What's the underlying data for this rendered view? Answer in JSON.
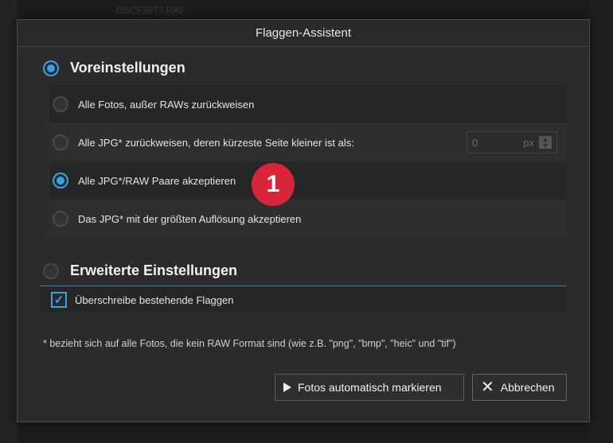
{
  "background": {
    "filename": "DSCF3977.RAF"
  },
  "dialog": {
    "title": "Flaggen-Assistent",
    "presets": {
      "label": "Voreinstellungen",
      "selected": true,
      "options": [
        {
          "label": "Alle Fotos, außer RAWs zurückweisen",
          "selected": false
        },
        {
          "label": "Alle JPG* zurückweisen, deren kürzeste Seite kleiner ist als:",
          "selected": false,
          "field_value": "0",
          "field_unit": "px"
        },
        {
          "label": "Alle JPG*/RAW Paare akzeptieren",
          "selected": true
        },
        {
          "label": "Das JPG* mit der größten Auflösung akzeptieren",
          "selected": false
        }
      ]
    },
    "badge": "1",
    "advanced": {
      "label": "Erweiterte Einstellungen",
      "selected": false,
      "overwrite_label": "Überschreibe bestehende Flaggen",
      "overwrite_checked": true
    },
    "footnote": "* bezieht sich auf alle Fotos, die kein RAW Format sind (wie z.B. \"png\", \"bmp\", \"heic\" und \"tif\")",
    "buttons": {
      "auto_mark": "Fotos automatisch markieren",
      "cancel": "Abbrechen"
    }
  },
  "colors": {
    "accent": "#3aa0e8",
    "badge": "#d8253a"
  },
  "icons": {
    "play": "play-icon",
    "close": "close-icon",
    "check": "check-icon"
  }
}
